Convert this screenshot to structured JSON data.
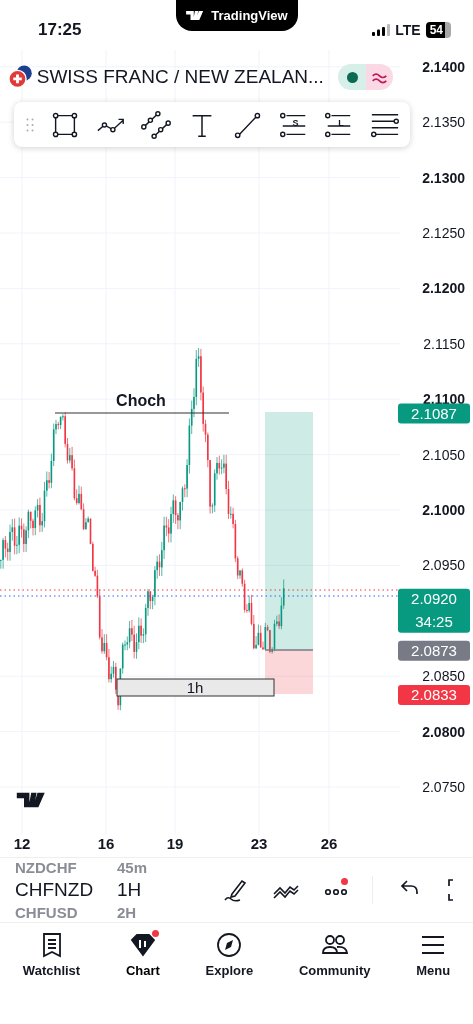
{
  "status_bar": {
    "time": "17:25",
    "app_pill": "TradingView",
    "network": "LTE",
    "battery": "54"
  },
  "symbol": {
    "title": "SWISS FRANC / NEW ZEALAN...",
    "market_open": true
  },
  "drawing_toolbar": {
    "tools": [
      {
        "kind": "rectangle"
      },
      {
        "kind": "path"
      },
      {
        "kind": "channel"
      },
      {
        "kind": "text"
      },
      {
        "kind": "trend-line"
      },
      {
        "kind": "lettered",
        "letter": "S"
      },
      {
        "kind": "lettered",
        "letter": "L"
      },
      {
        "kind": "lines"
      }
    ]
  },
  "chart": {
    "price_axis": [
      {
        "label": "2.1400",
        "bold": true
      },
      {
        "label": "2.1350",
        "bold": false
      },
      {
        "label": "2.1300",
        "bold": true
      },
      {
        "label": "2.1250",
        "bold": false
      },
      {
        "label": "2.1200",
        "bold": true
      },
      {
        "label": "2.1150",
        "bold": false
      },
      {
        "label": "2.1100",
        "bold": true
      },
      {
        "label": "2.1050",
        "bold": false
      },
      {
        "label": "2.1000",
        "bold": true
      },
      {
        "label": "2.0950",
        "bold": false
      },
      {
        "label": "2.0850",
        "bold": false
      },
      {
        "label": "2.0800",
        "bold": true
      },
      {
        "label": "2.0750",
        "bold": false
      }
    ],
    "time_axis": [
      "12",
      "16",
      "19",
      "23",
      "26"
    ],
    "annotation": "Choch",
    "range_box_label": "1h",
    "price_badges": [
      {
        "kind": "target",
        "price": "2.1087"
      },
      {
        "kind": "last",
        "price": "2.0920",
        "countdown": "34:25"
      },
      {
        "kind": "entry",
        "price": "2.0873"
      },
      {
        "kind": "stop",
        "price": "2.0833"
      }
    ]
  },
  "bottom_bar": {
    "symbols": [
      {
        "label": "NZDCHF",
        "selected": false
      },
      {
        "label": "CHFNZD",
        "selected": true
      },
      {
        "label": "CHFUSD",
        "selected": false
      }
    ],
    "intervals": [
      {
        "label": "45m",
        "selected": false
      },
      {
        "label": "1H",
        "selected": true
      },
      {
        "label": "2H",
        "selected": false
      }
    ],
    "more_badge": true
  },
  "tabs": [
    {
      "kind": "watchlist",
      "label": "Watchlist",
      "selected": false,
      "badge": false
    },
    {
      "kind": "chart",
      "label": "Chart",
      "selected": true,
      "badge": true
    },
    {
      "kind": "explore",
      "label": "Explore",
      "selected": false,
      "badge": false
    },
    {
      "kind": "community",
      "label": "Community",
      "selected": false,
      "badge": false
    },
    {
      "kind": "menu",
      "label": "Menu",
      "selected": false,
      "badge": false
    }
  ]
}
